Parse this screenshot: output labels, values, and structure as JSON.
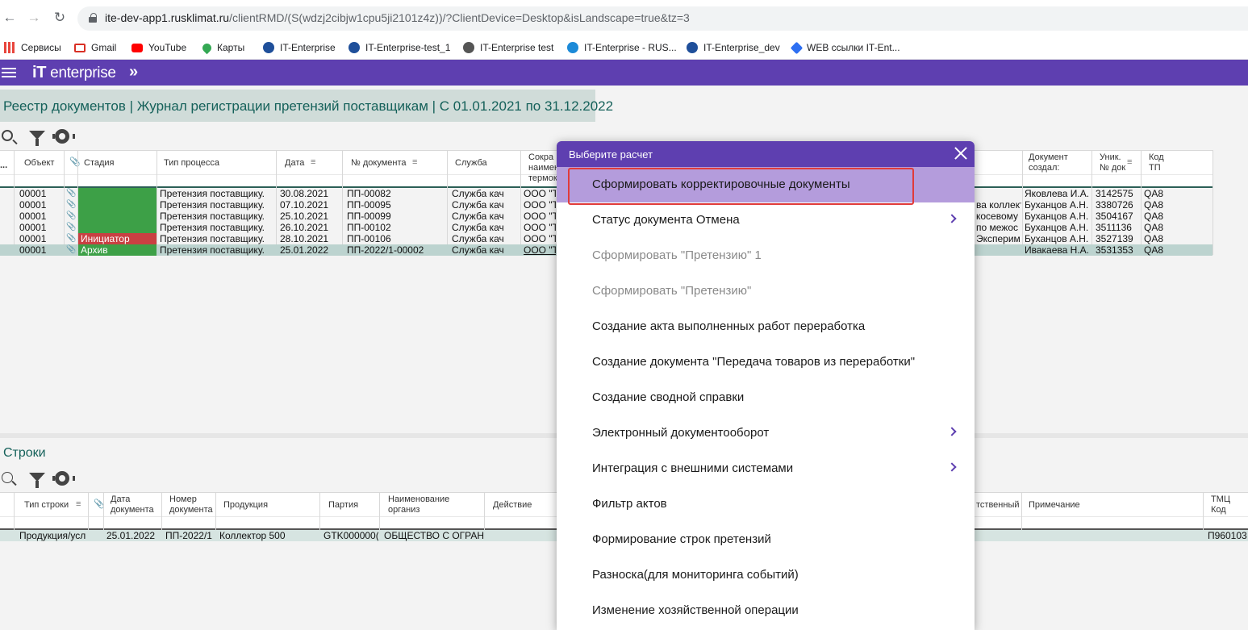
{
  "browser": {
    "back": "←",
    "forward": "→",
    "reload": "↻",
    "url_host": "ite-dev-app1.rusklimat.ru",
    "url_path": "/clientRMD/(S(wdzj2cibjw1cpu5ji2101z4z))/?ClientDevice=Desktop&isLandscape=true&tz=3"
  },
  "bookmarks": [
    {
      "label": "Сервисы",
      "icon": "apps-grid-icon",
      "color": "#e8453c"
    },
    {
      "label": "Gmail",
      "icon": "gmail-icon",
      "color": "#d93025"
    },
    {
      "label": "YouTube",
      "icon": "youtube-icon",
      "color": "#ff0000"
    },
    {
      "label": "Карты",
      "icon": "maps-icon",
      "color": "#34a853"
    },
    {
      "label": "IT-Enterprise",
      "icon": "it-enterprise-icon",
      "color": "#1f4f9a"
    },
    {
      "label": "IT-Enterprise-test_1",
      "icon": "it-enterprise-icon",
      "color": "#1f4f9a"
    },
    {
      "label": "IT-Enterprise test",
      "icon": "globe-icon",
      "color": "#555555"
    },
    {
      "label": "IT-Enterprise - RUS...",
      "icon": "edge-icon",
      "color": "#1c8ad8"
    },
    {
      "label": "IT-Enterprise_dev",
      "icon": "it-enterprise-icon",
      "color": "#1f4f9a"
    },
    {
      "label": "WEB ссылки IT-Ent...",
      "icon": "dropbox-icon",
      "color": "#2d6ff2"
    }
  ],
  "app": {
    "logo": "enterprise",
    "logo_prefix": "iT",
    "expand": "»",
    "accent": "#5e3fb0"
  },
  "page_title": "Реестр документов | Журнал регистрации претензий поставщикам | С 01.01.2021 по 31.12.2022",
  "top_table": {
    "headers": {
      "more": "...",
      "object": "Объект",
      "stage": "Стадия",
      "process": "Тип процесса",
      "date": "Дата",
      "docnum": "№ документа",
      "service": "Служба",
      "short1": "Сокра",
      "short2": "наимен",
      "short3": "термок",
      "created1": "Документ",
      "created2": "создал:",
      "uniq1": "Уник.",
      "uniq2": "№ док",
      "tp1": "Код",
      "tp2": "ТП"
    },
    "rows": [
      {
        "obj": "00001",
        "stage": "",
        "process": "Претензия поставщику.",
        "date": "30.08.2021",
        "num": "ПП-00082",
        "service": "Служба кач",
        "short": "ООО \"ТІ",
        "tail": "",
        "creator": "Яковлева И.А.",
        "uniq": "3142575",
        "tp": "QA8",
        "stage_color": "green"
      },
      {
        "obj": "00001",
        "stage": "",
        "process": "Претензия поставщику.",
        "date": "07.10.2021",
        "num": "ПП-00095",
        "service": "Служба кач",
        "short": "ООО \"ТІ",
        "tail": "ва коллект",
        "creator": "Буханцов А.Н.",
        "uniq": "3380726",
        "tp": "QA8",
        "stage_color": "green"
      },
      {
        "obj": "00001",
        "stage": "",
        "process": "Претензия поставщику.",
        "date": "25.10.2021",
        "num": "ПП-00099",
        "service": "Служба кач",
        "short": "ООО \"ТІ",
        "tail": "косевому",
        "creator": "Буханцов А.Н.",
        "uniq": "3504167",
        "tp": "QA8",
        "stage_color": "green"
      },
      {
        "obj": "00001",
        "stage": "",
        "process": "Претензия поставщику.",
        "date": "26.10.2021",
        "num": "ПП-00102",
        "service": "Служба кач",
        "short": "ООО \"ТІ",
        "tail": "по межос",
        "creator": "Буханцов А.Н.",
        "uniq": "3511136",
        "tp": "QA8",
        "stage_color": "green"
      },
      {
        "obj": "00001",
        "stage": "Инициатор",
        "process": "Претензия поставщику.",
        "date": "28.10.2021",
        "num": "ПП-00106",
        "service": "Служба кач",
        "short": "ООО \"ТІ",
        "tail": "Эксперим",
        "creator": "Буханцов А.Н.",
        "uniq": "3527139",
        "tp": "QA8",
        "stage_color": "red"
      },
      {
        "obj": "00001",
        "stage": "Архив",
        "process": "Претензия поставщику.",
        "date": "25.01.2022",
        "num": "ПП-2022/1-00002",
        "service": "Служба кач",
        "short": "ООО \"ТІ",
        "tail": "",
        "creator": "Ивакаева Н.А.",
        "uniq": "3531353",
        "tp": "QA8",
        "stage_color": "green"
      }
    ]
  },
  "bottom": {
    "title": "Строки",
    "headers": {
      "type": "Тип строки",
      "date1": "Дата",
      "date2": "документа",
      "num1": "Номер",
      "num2": "документа",
      "product": "Продукция",
      "batch": "Партия",
      "org1": "Наименование",
      "org2": "организ",
      "action": "Действие",
      "resp": "тственный",
      "note": "Примечание",
      "tmc1": "ТМЦ",
      "tmc2": "Код"
    },
    "row": {
      "type": "Продукция/усл",
      "date": "25.01.2022",
      "num": "ПП-2022/1",
      "product": "Коллектор 500",
      "batch": "GTK000000(",
      "org": "ОБЩЕСТВО С ОГРАНИ",
      "tmc": "П960103"
    }
  },
  "modal": {
    "title": "Выберите расчет",
    "items": [
      {
        "label": "Сформировать корректировочные документы",
        "state": "active",
        "submenu": false
      },
      {
        "label": "Статус документа Отмена",
        "state": "normal",
        "submenu": true
      },
      {
        "label": "Сформировать \"Претензию\" 1",
        "state": "disabled",
        "submenu": false
      },
      {
        "label": "Сформировать \"Претензию\"",
        "state": "disabled",
        "submenu": false
      },
      {
        "label": "Создание акта выполненных работ переработка",
        "state": "normal",
        "submenu": false
      },
      {
        "label": "Создание документа \"Передача товаров из переработки\"",
        "state": "normal",
        "submenu": false
      },
      {
        "label": "Создание сводной справки",
        "state": "normal",
        "submenu": false
      },
      {
        "label": "Электронный документооборот",
        "state": "normal",
        "submenu": true
      },
      {
        "label": "Интеграция с внешними системами",
        "state": "normal",
        "submenu": true
      },
      {
        "label": "Фильтр актов",
        "state": "normal",
        "submenu": false
      },
      {
        "label": "Формирование строк претензий",
        "state": "normal",
        "submenu": false
      },
      {
        "label": "Разноска(для мониторинга событий)",
        "state": "normal",
        "submenu": false
      },
      {
        "label": "Изменение хозяйственной операции",
        "state": "normal",
        "submenu": false
      }
    ]
  }
}
